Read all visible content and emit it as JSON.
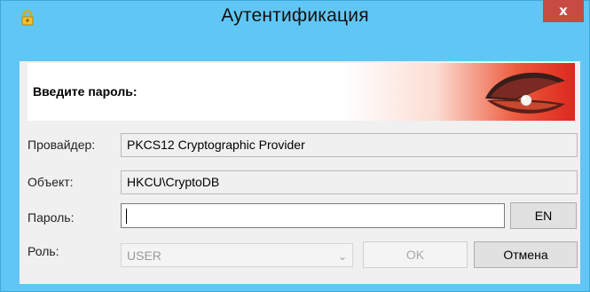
{
  "window": {
    "title": "Аутентификация",
    "close_glyph": "x"
  },
  "banner": {
    "prompt": "Введите пароль:"
  },
  "fields": {
    "provider_label": "Провайдер:",
    "provider_value": "PKCS12 Cryptographic Provider",
    "object_label": "Объект:",
    "object_value": "HKCU\\CryptoDB",
    "password_label": "Пароль:",
    "password_value": "",
    "role_label": "Роль:",
    "role_value": "USER"
  },
  "buttons": {
    "language": "EN",
    "ok": "OK",
    "cancel": "Отмена"
  },
  "icons": {
    "title_icon": "key-lock-icon",
    "banner_art": "seashell-pearl-icon",
    "combo_arrow": "chevron-down-icon"
  },
  "colors": {
    "frame": "#60c7f5",
    "close": "#c74a43",
    "banner_accent": "#dc281e"
  }
}
